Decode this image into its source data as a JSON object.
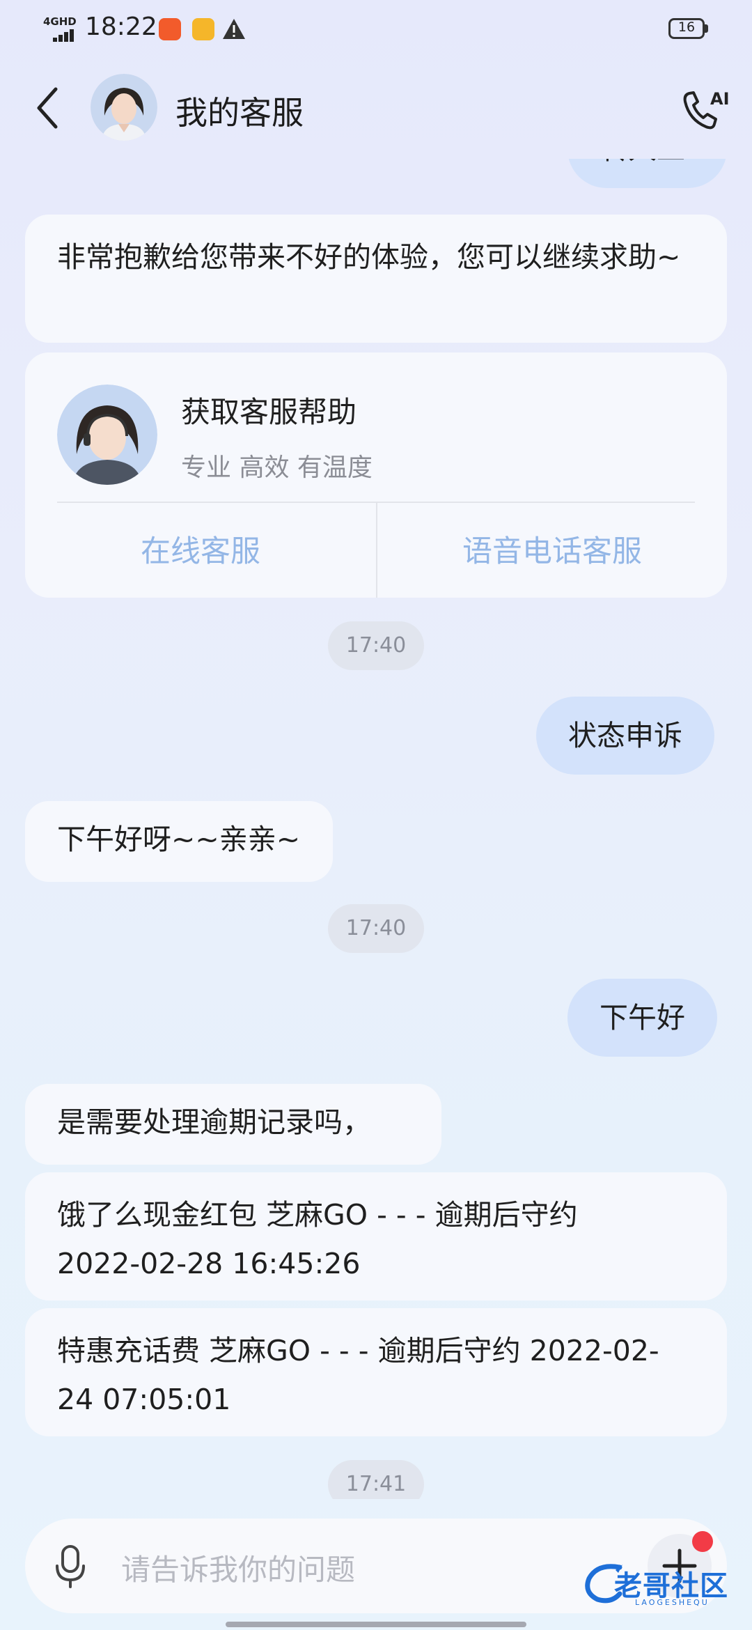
{
  "status_bar": {
    "time": "18:22",
    "network": "4GHD",
    "battery": "16"
  },
  "header": {
    "title": "我的客服",
    "call_icon_label": "AI"
  },
  "chat": {
    "partial_top_message": "转人工",
    "messages": [
      {
        "text": "非常抱歉给您带来不好的体验，您可以继续求助~"
      },
      {
        "text": "17:40"
      },
      {
        "text": "状态申诉"
      },
      {
        "text": "下午好呀~~亲亲~"
      },
      {
        "text": "17:40"
      },
      {
        "text": "下午好"
      },
      {
        "text": "是需要处理逾期记录吗，"
      },
      {
        "text": "饿了么现金红包 芝麻GO - - - 逾期后守约 2022-02-28 16:45:26"
      },
      {
        "text": "特惠充话费 芝麻GO - - - 逾期后守约 2022-02-24 07:05:01"
      },
      {
        "text": "17:41"
      }
    ],
    "help_card": {
      "title": "获取客服帮助",
      "subtitle": "专业 高效 有温度",
      "online_button": "在线客服",
      "voice_button": "语音电话客服"
    }
  },
  "input": {
    "placeholder": "请告诉我你的问题"
  },
  "watermark": {
    "text": "老哥社区",
    "sub": "LAOGESHEQU"
  },
  "colors": {
    "user_bubble": "#d3e2fb",
    "bot_bubble": "#f6f8fd",
    "card_button_text": "#93b6e6",
    "badge": "#f23b46"
  }
}
